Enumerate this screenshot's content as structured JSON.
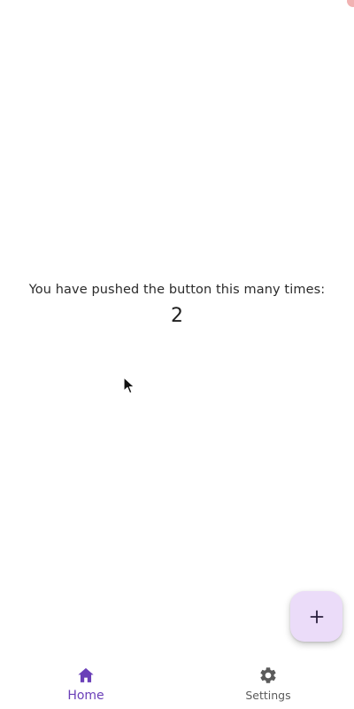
{
  "counter": {
    "label": "You have pushed the button this many times:",
    "value": "2"
  },
  "fab": {
    "icon": "plus-icon"
  },
  "bottom_nav": {
    "items": [
      {
        "label": "Home",
        "icon": "home-icon",
        "active": true
      },
      {
        "label": "Settings",
        "icon": "gear-icon",
        "active": false
      }
    ]
  },
  "colors": {
    "accent": "#6a3fb8",
    "fab_background": "#ebdcf9",
    "inactive": "#5b5b5b"
  }
}
